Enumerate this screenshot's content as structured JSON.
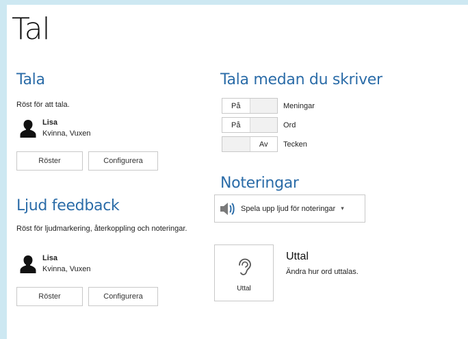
{
  "page": {
    "title": "Tal"
  },
  "tala": {
    "heading": "Tala",
    "description": "Röst för att tala.",
    "voice": {
      "name": "Lisa",
      "details": "Kvinna, Vuxen"
    },
    "voices_button": "Röster",
    "configure_button": "Configurera"
  },
  "feedback": {
    "heading": "Ljud feedback",
    "description": "Röst för ljudmarkering, återkoppling och noteringar.",
    "voice": {
      "name": "Lisa",
      "details": "Kvinna, Vuxen"
    },
    "voices_button": "Röster",
    "configure_button": "Configurera"
  },
  "typing": {
    "heading": "Tala medan du skriver",
    "rows": [
      {
        "state": "På",
        "label": "Meningar"
      },
      {
        "state": "På",
        "label": "Ord"
      },
      {
        "state": "Av",
        "label": "Tecken"
      }
    ]
  },
  "notes": {
    "heading": "Noteringar",
    "dropdown_value": "Spela upp ljud för noteringar",
    "icon": "speaker-icon"
  },
  "pronunciation": {
    "tile_label": "Uttal",
    "icon": "ear-icon",
    "heading": "Uttal",
    "description": "Ändra hur ord uttalas."
  },
  "colors": {
    "accent": "#2b6ca8",
    "frame": "#cde8f2"
  }
}
